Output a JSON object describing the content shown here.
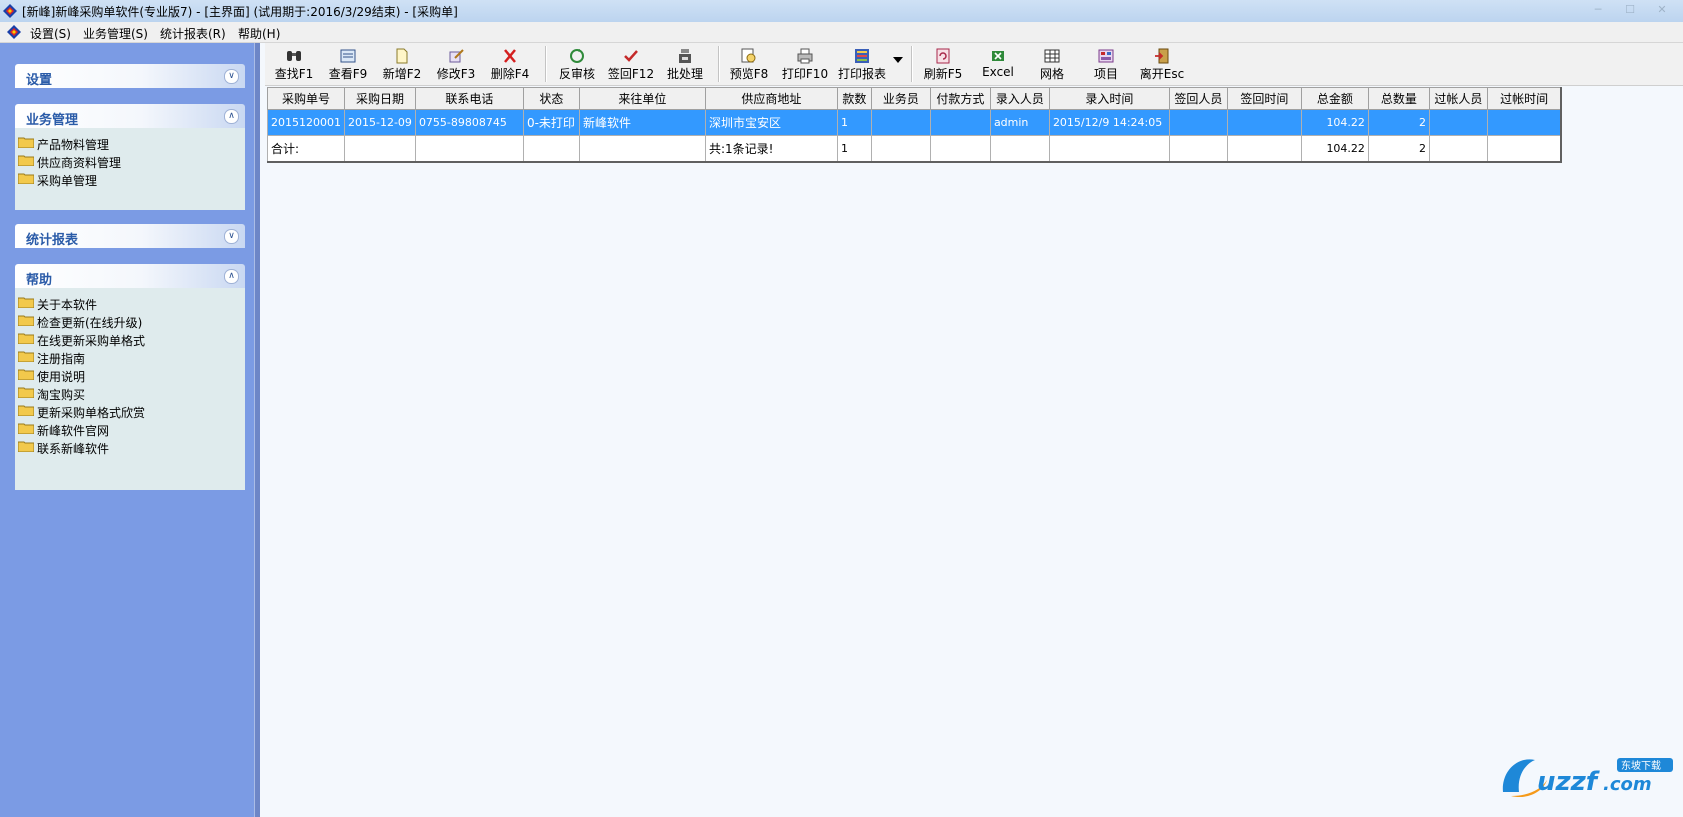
{
  "window": {
    "title": "[新峰]新峰采购单软件(专业版7) - [主界面] (试用期于:2016/3/29结束) - [采购单]"
  },
  "menubar": {
    "items": [
      "设置(S)",
      "业务管理(S)",
      "统计报表(R)",
      "帮助(H)"
    ]
  },
  "sidebar": {
    "groups": [
      {
        "label": "设置",
        "state": "collapsed",
        "items": []
      },
      {
        "label": "业务管理",
        "state": "expanded",
        "items": [
          "产品物料管理",
          "供应商资料管理",
          "采购单管理"
        ]
      },
      {
        "label": "统计报表",
        "state": "collapsed",
        "items": []
      },
      {
        "label": "帮助",
        "state": "expanded",
        "items": [
          "关于本软件",
          "检查更新(在线升级)",
          "在线更新采购单格式",
          "注册指南",
          "使用说明",
          "淘宝购买",
          "更新采购单格式欣赏",
          "新峰软件官网",
          "联系新峰软件"
        ]
      }
    ]
  },
  "toolbar": {
    "buttons": [
      {
        "label": "查找F1",
        "icon": "binoculars-icon"
      },
      {
        "label": "查看F9",
        "icon": "view-icon"
      },
      {
        "label": "新增F2",
        "icon": "new-document-icon"
      },
      {
        "label": "修改F3",
        "icon": "edit-icon"
      },
      {
        "label": "删除F4",
        "icon": "delete-icon"
      },
      {
        "label": "反审核",
        "icon": "unaudit-icon"
      },
      {
        "label": "签回F12",
        "icon": "checkmark-icon"
      },
      {
        "label": "批处理",
        "icon": "batch-icon"
      },
      {
        "label": "预览F8",
        "icon": "preview-icon"
      },
      {
        "label": "打印F10",
        "icon": "printer-icon"
      },
      {
        "label": "打印报表",
        "icon": "report-icon"
      },
      {
        "label": "刷新F5",
        "icon": "refresh-icon"
      },
      {
        "label": "Excel",
        "icon": "excel-icon"
      },
      {
        "label": "网格",
        "icon": "grid-icon"
      },
      {
        "label": "项目",
        "icon": "project-icon"
      },
      {
        "label": "离开Esc",
        "icon": "exit-icon"
      }
    ]
  },
  "grid": {
    "columns": [
      "采购单号",
      "采购日期",
      "联系电话",
      "状态",
      "来往单位",
      "供应商地址",
      "款数",
      "业务员",
      "付款方式",
      "录入人员",
      "录入时间",
      "签回人员",
      "签回时间",
      "总金额",
      "总数量",
      "过帐人员",
      "过帐时间"
    ],
    "rows": [
      [
        "2015120001",
        "2015-12-09",
        "0755-89808745",
        "0-未打印",
        "新峰软件",
        "深圳市宝安区",
        "1",
        "",
        "",
        "admin",
        "2015/12/9 14:24:05",
        "",
        "",
        "104.22",
        "2",
        "",
        ""
      ]
    ],
    "total_row": [
      "合计:",
      "",
      "",
      "",
      "",
      "共:1条记录!",
      "1",
      "",
      "",
      "",
      "",
      "",
      "",
      "104.22",
      "2",
      "",
      ""
    ]
  },
  "watermark": {
    "text": "uzzf.com",
    "subtext": "东坡下载"
  },
  "colors": {
    "sidebar_bg": "#7b9be4",
    "selected_row": "#3399ff",
    "group_label": "#2a5ba8"
  }
}
